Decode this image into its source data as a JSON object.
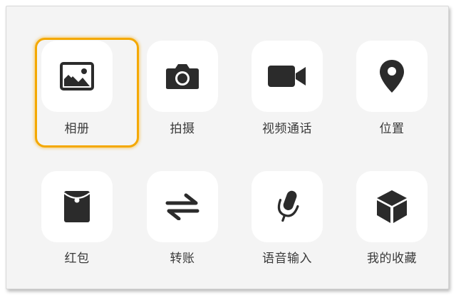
{
  "grid": {
    "items": [
      {
        "label": "相册",
        "icon": "photo-album-icon"
      },
      {
        "label": "拍摄",
        "icon": "camera-icon"
      },
      {
        "label": "视频通话",
        "icon": "video-call-icon"
      },
      {
        "label": "位置",
        "icon": "location-pin-icon"
      },
      {
        "label": "红包",
        "icon": "red-packet-icon"
      },
      {
        "label": "转账",
        "icon": "transfer-arrows-icon"
      },
      {
        "label": "语音输入",
        "icon": "microphone-icon"
      },
      {
        "label": "我的收藏",
        "icon": "favorites-cube-icon"
      }
    ],
    "selected_index": 0
  },
  "colors": {
    "panel_bg": "#f4f4f4",
    "tile_bg": "#ffffff",
    "icon": "#2b2b2b",
    "label": "#3a3a3a",
    "highlight": "#f4a800"
  }
}
